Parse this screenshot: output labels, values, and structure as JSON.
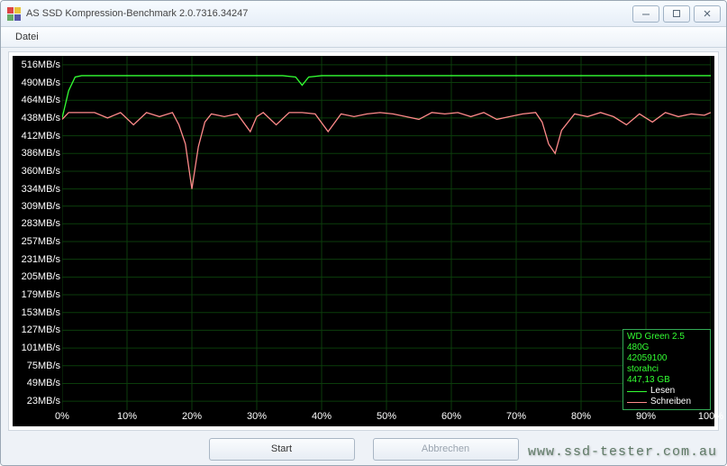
{
  "window": {
    "title": "AS SSD Kompression-Benchmark 2.0.7316.34247"
  },
  "menu": {
    "datei": "Datei"
  },
  "footer": {
    "start": "Start",
    "abbrechen": "Abbrechen"
  },
  "watermark": "www.ssd-tester.com.au",
  "legend": {
    "device": "WD Green 2.5 480G",
    "serial": "42059100",
    "driver": "storahci",
    "capacity": "447,13 GB",
    "lesen": "Lesen",
    "schreiben": "Schreiben"
  },
  "chart_data": {
    "type": "line",
    "xlabel": "",
    "ylabel": "",
    "xunit": "%",
    "yunit": "MB/s",
    "ylim": [
      10,
      529
    ],
    "xlim": [
      0,
      100
    ],
    "yticks": [
      23,
      49,
      75,
      101,
      127,
      153,
      179,
      205,
      231,
      257,
      283,
      309,
      334,
      360,
      386,
      412,
      438,
      464,
      490,
      516
    ],
    "xticks": [
      0,
      10,
      20,
      30,
      40,
      50,
      60,
      70,
      80,
      90,
      100
    ],
    "series": [
      {
        "name": "Lesen",
        "color": "#33ff33",
        "x": [
          0,
          1,
          2,
          3,
          5,
          10,
          15,
          20,
          25,
          30,
          34,
          36,
          37,
          38,
          40,
          45,
          50,
          55,
          60,
          65,
          70,
          75,
          80,
          85,
          90,
          95,
          100
        ],
        "y": [
          438,
          478,
          498,
          500,
          500,
          500,
          500,
          500,
          500,
          500,
          500,
          498,
          486,
          498,
          500,
          500,
          500,
          500,
          500,
          500,
          500,
          500,
          500,
          500,
          500,
          500,
          500
        ]
      },
      {
        "name": "Schreiben",
        "color": "#ff8a8a",
        "x": [
          0,
          1,
          3,
          5,
          7,
          9,
          11,
          13,
          15,
          17,
          18,
          19,
          20,
          21,
          22,
          23,
          25,
          27,
          29,
          30,
          31,
          33,
          35,
          37,
          39,
          41,
          43,
          45,
          47,
          49,
          51,
          53,
          55,
          57,
          59,
          61,
          63,
          65,
          67,
          69,
          71,
          73,
          74,
          75,
          76,
          77,
          79,
          81,
          83,
          85,
          87,
          89,
          91,
          93,
          95,
          97,
          99,
          100
        ],
        "y": [
          436,
          446,
          446,
          446,
          438,
          446,
          428,
          446,
          440,
          446,
          428,
          400,
          334,
          396,
          432,
          444,
          440,
          444,
          418,
          440,
          446,
          428,
          446,
          446,
          444,
          418,
          444,
          440,
          444,
          446,
          444,
          440,
          436,
          446,
          444,
          446,
          440,
          446,
          436,
          440,
          444,
          446,
          432,
          400,
          386,
          420,
          444,
          440,
          446,
          440,
          428,
          444,
          432,
          446,
          440,
          444,
          442,
          446
        ]
      }
    ]
  }
}
